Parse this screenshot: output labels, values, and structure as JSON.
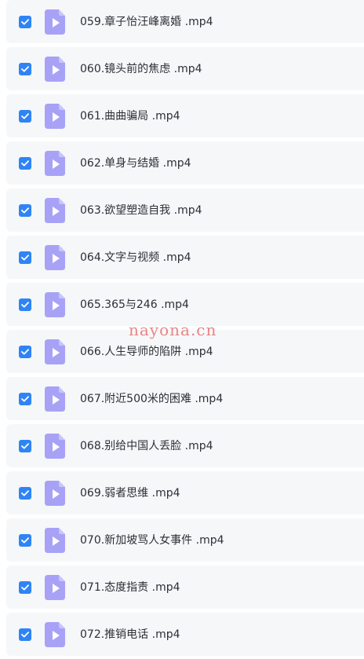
{
  "files": [
    {
      "name": "059.章子怡汪峰离婚 .mp4",
      "checked": true
    },
    {
      "name": "060.镜头前的焦虑 .mp4",
      "checked": true
    },
    {
      "name": "061.曲曲骗局 .mp4",
      "checked": true
    },
    {
      "name": "062.单身与结婚 .mp4",
      "checked": true
    },
    {
      "name": "063.欲望塑造自我 .mp4",
      "checked": true
    },
    {
      "name": "064.文字与视频 .mp4",
      "checked": true
    },
    {
      "name": "065.365与246 .mp4",
      "checked": true
    },
    {
      "name": "066.人生导师的陷阱 .mp4",
      "checked": true
    },
    {
      "name": "067.附近500米的困难 .mp4",
      "checked": true
    },
    {
      "name": "068.别给中国人丢脸 .mp4",
      "checked": true
    },
    {
      "name": "069.弱者思维 .mp4",
      "checked": true
    },
    {
      "name": "070.新加坡骂人女事件 .mp4",
      "checked": true
    },
    {
      "name": "071.态度指责 .mp4",
      "checked": true
    },
    {
      "name": "072.推销电话 .mp4",
      "checked": true
    }
  ],
  "watermark": "nayona.cn",
  "icons": {
    "checkbox": "checkmark-icon",
    "file": "video-file-icon"
  },
  "colors": {
    "checkbox": "#2f84f5",
    "file_icon": "#a8a2f7",
    "file_icon_fold": "#c9c5fb",
    "row_background": "#f6f7f9",
    "watermark": "#e87878"
  }
}
